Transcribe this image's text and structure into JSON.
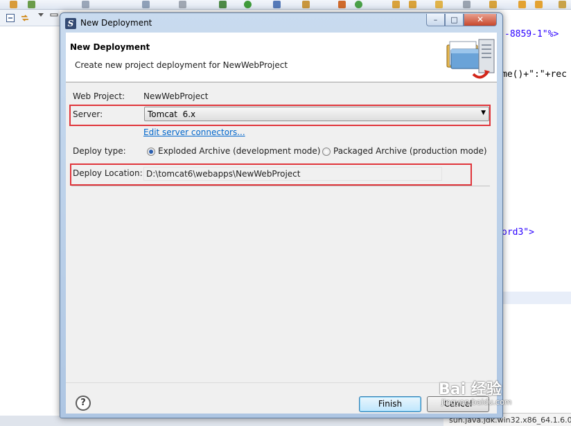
{
  "dialog": {
    "title": "New Deployment",
    "banner": {
      "title": "New Deployment",
      "description": "Create new project deployment for NewWebProject"
    },
    "web_project": {
      "label": "Web Project:",
      "value": "NewWebProject"
    },
    "server": {
      "label": "Server:",
      "selected": "Tomcat  6.x"
    },
    "edit_server_link": "Edit server connectors...",
    "deploy_type": {
      "label": "Deploy type:",
      "options": [
        {
          "label": "Exploded Archive (development mode)",
          "checked": true
        },
        {
          "label": "Packaged Archive (production mode)",
          "checked": false
        }
      ]
    },
    "deploy_location": {
      "label": "Deploy Location:",
      "value": "D:\\tomcat6\\webapps\\NewWebProject"
    },
    "buttons": {
      "help": "?",
      "finish": "Finish",
      "cancel": "Cancel"
    },
    "window_controls": {
      "minimize": "–",
      "maximize": "□",
      "close": "✕"
    }
  },
  "editor": {
    "lines": [
      {
        "text": "-8859-1\"%>"
      },
      {
        "text": "me()+\":\"+rec"
      },
      {
        "text": "ord3\">"
      }
    ]
  },
  "console": {
    "text": "sun.java.jdk.win32.x86_64.1.6.0"
  },
  "watermark": {
    "main": "Bai 经验",
    "sub": "jingyan.baidu.com"
  },
  "colors": {
    "highlight_box": "#e0343a",
    "link": "#0066cc",
    "code_string": "#2a00ff",
    "code_tag": "#7f007f",
    "code_keyword": "#7f0055"
  }
}
